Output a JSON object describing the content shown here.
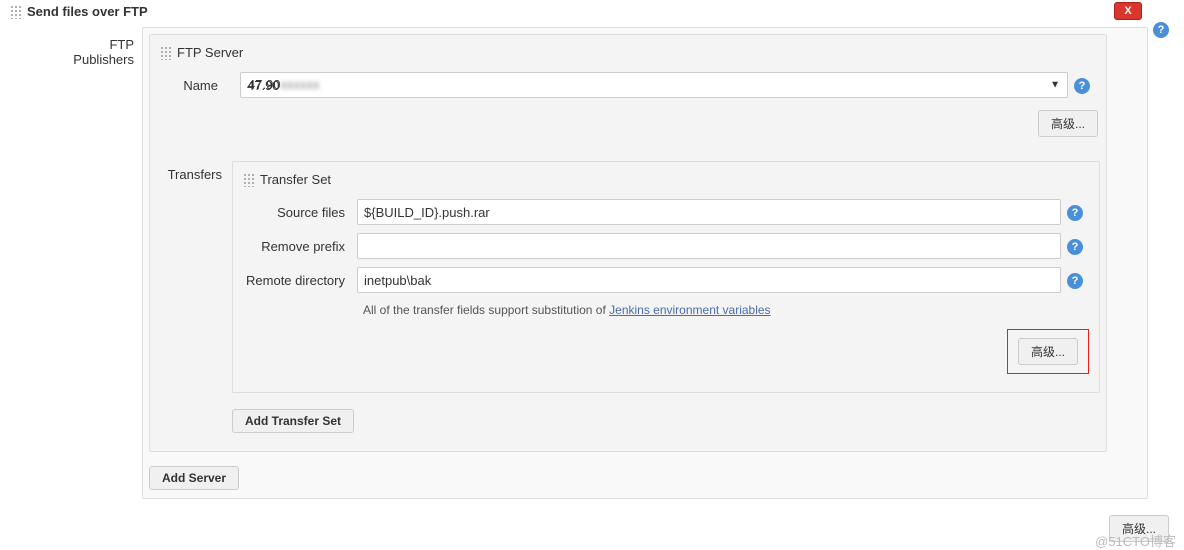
{
  "header": {
    "title": "Send files over FTP"
  },
  "close_label": "X",
  "side": {
    "publishers_label": "FTP Publishers",
    "transfers_label": "Transfers"
  },
  "ftp_server": {
    "box_title": "FTP Server",
    "name_label": "Name",
    "name_value": "47.90",
    "name_suffix_hidden": "xxxxxx",
    "advanced_label": "高级..."
  },
  "transfer_set": {
    "box_title": "Transfer Set",
    "source_files_label": "Source files",
    "source_files_value": "${BUILD_ID}.push.rar",
    "remove_prefix_label": "Remove prefix",
    "remove_prefix_value": "",
    "remote_dir_label": "Remote directory",
    "remote_dir_value": "inetpub\\bak",
    "note_prefix": "All of the transfer fields support substitution of ",
    "note_link": "Jenkins environment variables",
    "advanced_label": "高级..."
  },
  "buttons": {
    "add_transfer_set": "Add Transfer Set",
    "add_server": "Add Server",
    "bottom_advanced": "高级..."
  },
  "watermark": "@51CTO博客"
}
